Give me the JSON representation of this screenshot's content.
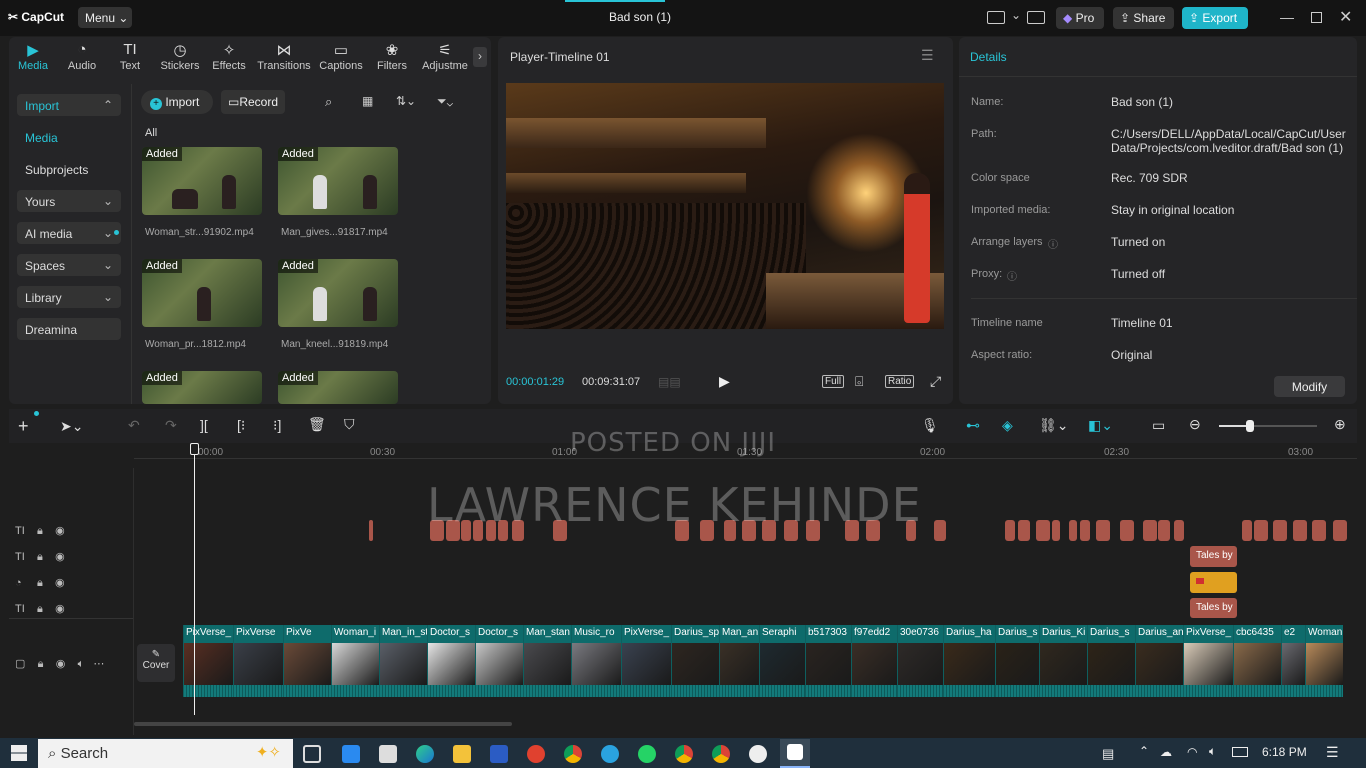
{
  "titlebar": {
    "app_name": "CapCut",
    "menu_label": "Menu",
    "project_title": "Bad son (1)",
    "pro_label": "Pro",
    "share_label": "Share",
    "export_label": "Export"
  },
  "toolbar_tabs": [
    {
      "label": "Media",
      "icon": "media-icon"
    },
    {
      "label": "Audio",
      "icon": "audio-icon"
    },
    {
      "label": "Text",
      "icon": "text-icon"
    },
    {
      "label": "Stickers",
      "icon": "stickers-icon"
    },
    {
      "label": "Effects",
      "icon": "effects-icon"
    },
    {
      "label": "Transitions",
      "icon": "transitions-icon"
    },
    {
      "label": "Captions",
      "icon": "captions-icon"
    },
    {
      "label": "Filters",
      "icon": "filters-icon"
    },
    {
      "label": "Adjustme",
      "icon": "adjustment-icon"
    }
  ],
  "sidebar": {
    "items": [
      {
        "label": "Import"
      },
      {
        "label": "Media"
      },
      {
        "label": "Subprojects"
      },
      {
        "label": "Yours"
      },
      {
        "label": "AI media"
      },
      {
        "label": "Spaces"
      },
      {
        "label": "Library"
      },
      {
        "label": "Dreamina"
      }
    ]
  },
  "media": {
    "import_label": "Import",
    "record_label": "Record",
    "filter_label": "All",
    "added_badge": "Added",
    "items": [
      {
        "name": "Woman_str...91902.mp4"
      },
      {
        "name": "Man_gives...91817.mp4"
      },
      {
        "name": "Woman_pr...1812.mp4"
      },
      {
        "name": "Man_kneel...91819.mp4"
      }
    ]
  },
  "player": {
    "title": "Player-Timeline 01",
    "current_time": "00:00:01:29",
    "total_time": "00:09:31:07",
    "full_label": "Full",
    "ratio_label": "Ratio"
  },
  "details": {
    "header": "Details",
    "modify_label": "Modify",
    "rows": [
      {
        "label": "Name:",
        "value": "Bad son (1)"
      },
      {
        "label": "Path:",
        "value": "C:/Users/DELL/AppData/Local/CapCut/User Data/Projects/com.lveditor.draft/Bad son (1)"
      },
      {
        "label": "Color space",
        "value": "Rec. 709 SDR"
      },
      {
        "label": "Imported media:",
        "value": "Stay in original location"
      },
      {
        "label": "Arrange layers",
        "value": "Turned on"
      },
      {
        "label": "Proxy:",
        "value": "Turned off"
      },
      {
        "label": "Timeline name",
        "value": "Timeline 01"
      },
      {
        "label": "Aspect ratio:",
        "value": "Original"
      }
    ]
  },
  "timeline": {
    "ruler": [
      "00:00",
      "00:30",
      "01:00",
      "01:30",
      "02:00",
      "02:30",
      "03:00"
    ],
    "cover_label": "Cover",
    "text_clip_labels": [
      "Tales by",
      "Tales by"
    ],
    "video_clips": [
      "PixVerse_",
      "PixVerse",
      "PixVe",
      "Woman_i",
      "Man_in_st",
      "Doctor_s",
      "Doctor_s",
      "Man_stan",
      "Music_ro",
      "PixVerse_",
      "Darius_sp",
      "Man_an",
      "Seraphi",
      "b517303",
      "f97edd2",
      "30e0736",
      "Darius_ha",
      "Darius_s",
      "Darius_Ki",
      "Darius_s",
      "Darius_an",
      "PixVerse_",
      "cbc6435",
      "e2",
      "Woman"
    ]
  },
  "watermarks": {
    "line1": "POSTED ON JIJI",
    "line2": "LAWRENCE KEHINDE"
  },
  "taskbar": {
    "search_placeholder": "Search",
    "time": "6:18 PM"
  },
  "colors": {
    "accent": "#29c4d6",
    "text_clip": "#a9564a",
    "video_clip": "#0e6b6b",
    "export_bg": "#1fb5c9"
  }
}
